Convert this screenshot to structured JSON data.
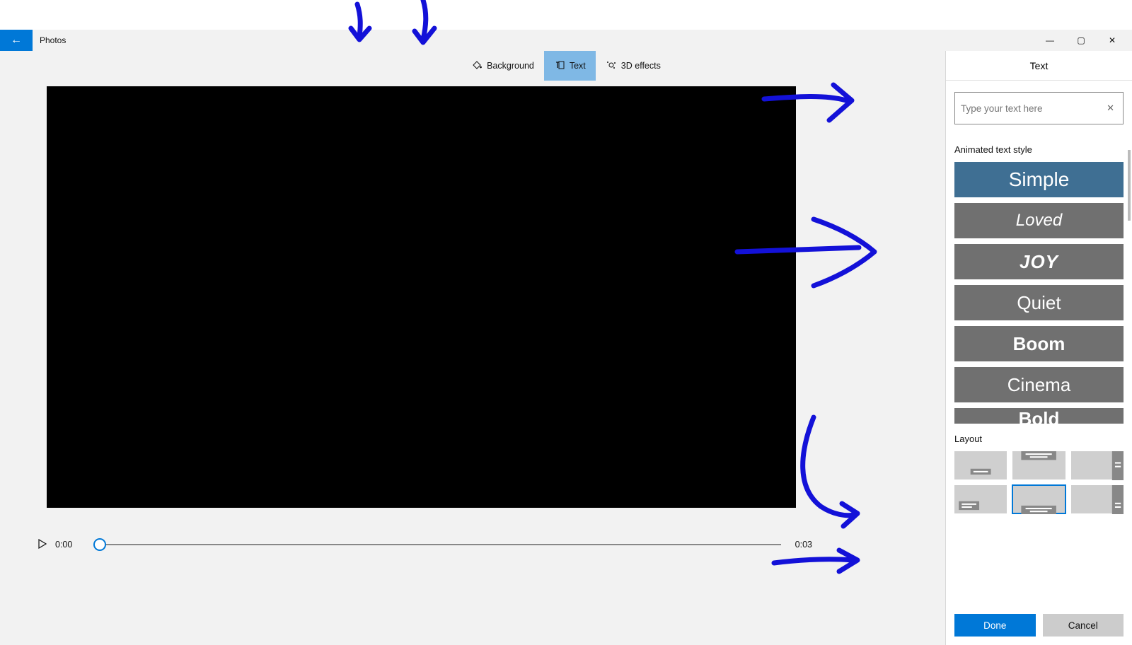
{
  "app_title": "Photos",
  "window_controls": {
    "min": "—",
    "max": "▢",
    "close": "✕"
  },
  "toolbar": {
    "background": "Background",
    "text": "Text",
    "fx": "3D effects",
    "active": "text"
  },
  "playback": {
    "current": "0:00",
    "end": "0:03"
  },
  "sidepanel": {
    "title": "Text",
    "placeholder": "Type your text here",
    "styles_label": "Animated text style",
    "styles": [
      {
        "id": "simple",
        "label": "Simple",
        "selected": true
      },
      {
        "id": "loved",
        "label": "Loved",
        "selected": false
      },
      {
        "id": "joy",
        "label": "JOY",
        "selected": false
      },
      {
        "id": "quiet",
        "label": "Quiet",
        "selected": false
      },
      {
        "id": "boom",
        "label": "Boom",
        "selected": false
      },
      {
        "id": "cinema",
        "label": "Cinema",
        "selected": false
      },
      {
        "id": "bold",
        "label": "Bold",
        "selected": false
      }
    ],
    "layout_label": "Layout",
    "layout_selected_index": 4,
    "done": "Done",
    "cancel": "Cancel"
  },
  "colors": {
    "accent": "#0078d7",
    "annotation": "#1311d8"
  }
}
